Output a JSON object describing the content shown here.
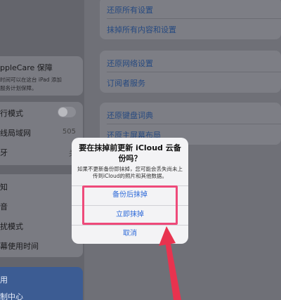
{
  "sidebar": {
    "applecare_label": "ppleCare 保障",
    "applecare_desc1": "时间可以在这台 iPad 添加",
    "applecare_desc2": "服务计划保障。",
    "row1": "行模式",
    "row2": "线局域网",
    "row2_value": "505",
    "row3": "牙",
    "row3_value": "关",
    "row4": "知",
    "row5": "音",
    "row6": "扰模式",
    "row7": "幕使用时间",
    "selected_item": "用",
    "row9": "制中心"
  },
  "main": {
    "reset_all_settings": "还原所有设置",
    "erase_all": "抹掉所有内容和设置",
    "reset_network": "还原网络设置",
    "subscriber_service": "订阅者服务",
    "reset_keyboard": "还原键盘词典",
    "reset_home": "还原主屏幕布局"
  },
  "dialog": {
    "title": "要在抹掉前更新 iCloud 云备份吗？",
    "message": "如果不更新备份即抹掉，您可能会丢失尚未上传到iCloud的照片和其他数据。",
    "backup_then_erase": "备份后抹掉",
    "erase_now": "立即抹掉",
    "cancel": "取消"
  },
  "colors": {
    "highlight": "#ee4a7a",
    "arrow": "#e8334f",
    "link": "#2f6bd9"
  }
}
